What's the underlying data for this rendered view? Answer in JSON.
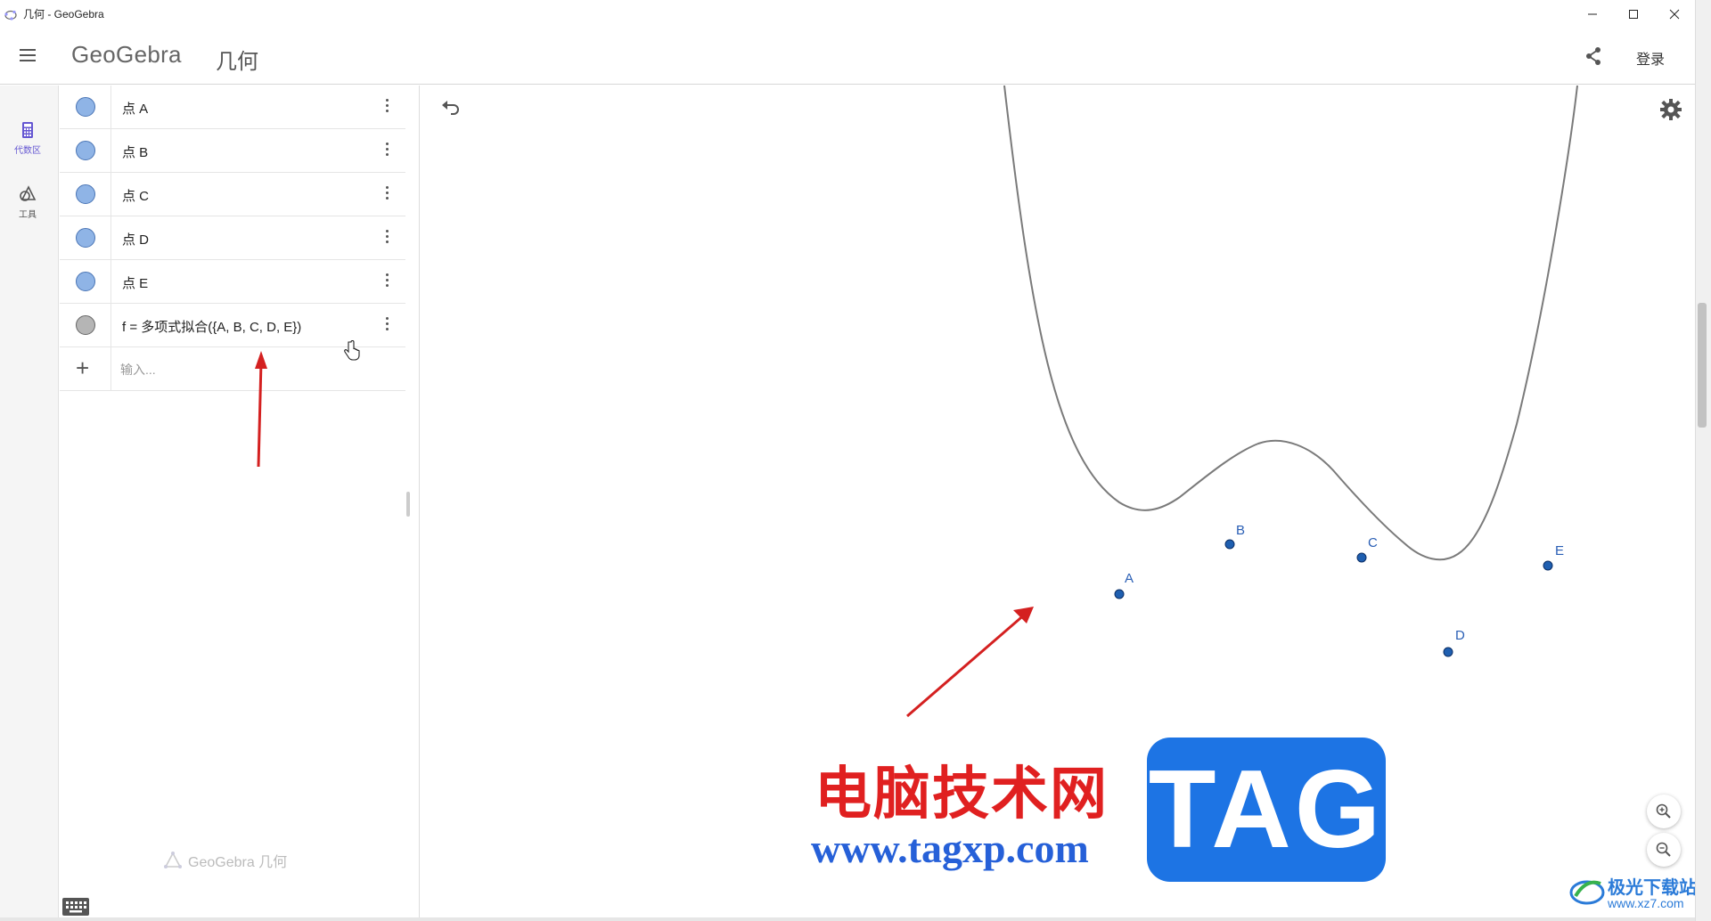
{
  "window": {
    "title": "几何 - GeoGebra",
    "controls": [
      "minimize",
      "maximize",
      "close"
    ]
  },
  "header": {
    "brand": "GeoGebra",
    "app_name": "几何",
    "login_label": "登录"
  },
  "rail": {
    "items": [
      {
        "label": "代数区",
        "icon": "calculator-icon",
        "active": true
      },
      {
        "label": "工具",
        "icon": "tools-icon",
        "active": false
      }
    ]
  },
  "algebra": {
    "rows": [
      {
        "text": "点 A",
        "marble": "blue"
      },
      {
        "text": "点 B",
        "marble": "blue"
      },
      {
        "text": "点 C",
        "marble": "blue"
      },
      {
        "text": "点 D",
        "marble": "blue"
      },
      {
        "text": "点 E",
        "marble": "blue"
      },
      {
        "text": "f = 多项式拟合({A, B, C, D, E})",
        "marble": "grey"
      }
    ],
    "input_placeholder": "输入...",
    "footer": "GeoGebra 几何"
  },
  "graphics": {
    "points": [
      {
        "label": "A"
      },
      {
        "label": "B"
      },
      {
        "label": "C"
      },
      {
        "label": "D"
      },
      {
        "label": "E"
      }
    ],
    "colors": {
      "point": "#1f5fb0",
      "curve": "#7a7a7a",
      "arrow": "#d42020"
    }
  },
  "watermark": {
    "cn": "电脑技术网",
    "url": "www.tagxp.com",
    "tag": "TAG",
    "site_name": "极光下载站",
    "site_url": "www.xz7.com"
  },
  "colors": {
    "accent": "#6557d2",
    "marble_blue": "#8fb4e6",
    "marble_grey": "#b5b5b5"
  }
}
